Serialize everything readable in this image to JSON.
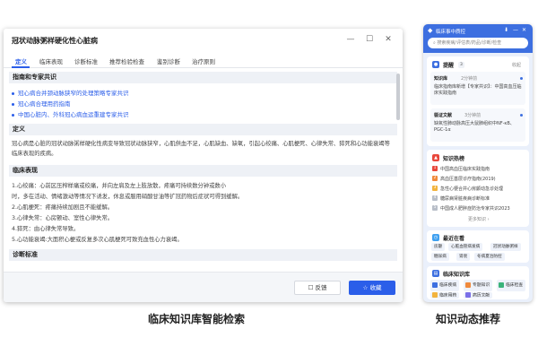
{
  "dialog": {
    "title": "冠状动脉粥样硬化性心脏病",
    "tabs": [
      "定义",
      "临床表现",
      "诊断标准",
      "推荐检验检查",
      "鉴别诊断",
      "治疗原则"
    ],
    "guides_heading": "指南和专家共识",
    "guides": [
      "冠心病合并颈动脉狭窄的处理策略专家共识",
      "冠心病合理用药指南",
      "中国心脏内、外科冠心病血运重建专家共识"
    ],
    "definition_heading": "定义",
    "definition_text": "冠心病是心脏的冠状动脉粥样硬化性病变导致冠状动脉狭窄，心肌供血不足，心肌缺血、缺氧，引起心绞痛、心肌梗死、心律失常、猝死和心功能衰竭等临床表现的疾病。",
    "clinical_heading": "临床表现",
    "clinical_lines": [
      "1.心绞痛：心前区压榨样痛或绞痛，并向左肩及左上肢放散，疼痛可持续数分钟或数小",
      "时，多在活动、情绪激动等情况下诱发，休息或服用硝酸甘油等扩冠药物后症状可得到缓解。",
      "2.心肌梗死：疼痛持续加剧且不能缓解。",
      "3.心律失常：心房颤动、室性心律失常。",
      "4.猝死：由心律失常导致。",
      "5.心功能衰竭:大面积心梗或反复多次心肌梗死可致充血性心力衰竭。"
    ],
    "diagnosis_heading": "诊断标准",
    "footer": {
      "feedback_label": "反馈",
      "collect_label": "收藏"
    }
  },
  "phone": {
    "title": "临床事中质控",
    "search_placeholder": "搜索疾病/评估表/药品/诊断/检查",
    "reminder": {
      "title": "提醒",
      "count": "3",
      "action": "收起",
      "items": [
        {
          "tag": "知识库",
          "time": "2分钟前",
          "text": "临床指南库新增【专家共识】：中国高血压临床实践指南"
        },
        {
          "tag": "循证文献",
          "time": "3分钟前",
          "text": "缺氧性肺动脉高压大鼠肺组织中NF-κB、PGC-1α"
        }
      ]
    },
    "hot": {
      "title": "知识热榜",
      "items": [
        "中国高血压临床实践指南",
        "高血压基层诊疗指南(2019)",
        "急性心梗合并心房颤动急诊处理",
        "糖尿病肾脏疾病诊断标准",
        "中国成人肥胖症防治专家共识2023"
      ],
      "more": "更多知识"
    },
    "recent": {
      "title": "最近在看",
      "chips": [
        "房颤",
        "心脏血管病发病",
        "冠状动脉粥样",
        "糖尿病",
        "肾衰",
        "冬病夏治防控"
      ]
    },
    "library": {
      "title": "临床知识库",
      "items": [
        "临床疾病",
        "专题知识",
        "临床检查",
        "临床用药",
        "病历文献"
      ]
    }
  },
  "captions": {
    "left": "临床知识库智能检索",
    "right": "知识动态推荐"
  },
  "colors": {
    "primary": "#2b5ee9",
    "phone_header": "#3d6fe0",
    "section_bg": "#eef1f6",
    "hot_icon": "#e8473b",
    "recent_icon": "#3fa0f0",
    "library_icon": "#3d6fe0"
  }
}
